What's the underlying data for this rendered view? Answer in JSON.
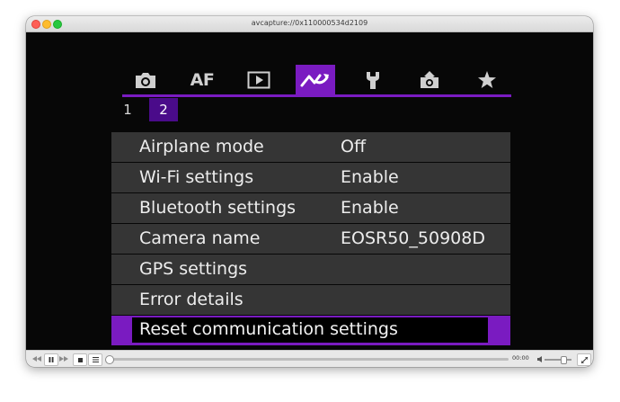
{
  "window": {
    "title": "avcapture://0x110000534d2109"
  },
  "camera_menu": {
    "tabs": [
      {
        "name": "camera-shooting",
        "icon": "camera-icon"
      },
      {
        "name": "af",
        "label": "AF",
        "icon": "af-text"
      },
      {
        "name": "playback",
        "icon": "playback-icon"
      },
      {
        "name": "wireless",
        "icon": "wireless-communication-icon",
        "active": true
      },
      {
        "name": "setup",
        "icon": "wrench-icon"
      },
      {
        "name": "custom-functions",
        "icon": "custom-camera-icon"
      },
      {
        "name": "my-menu",
        "icon": "star-icon"
      }
    ],
    "subtabs": [
      {
        "label": "1",
        "active": false
      },
      {
        "label": "2",
        "active": true
      }
    ],
    "items": [
      {
        "label": "Airplane mode",
        "value": "Off"
      },
      {
        "label": "Wi-Fi settings",
        "value": "Enable"
      },
      {
        "label": "Bluetooth settings",
        "value": "Enable"
      },
      {
        "label": "Camera name",
        "value": "EOSR50_50908D"
      },
      {
        "label": "GPS settings",
        "value": ""
      },
      {
        "label": "Error details",
        "value": ""
      },
      {
        "label": "Reset communication settings",
        "value": "",
        "selected": true
      }
    ],
    "colors": {
      "accent": "#7a1bc1",
      "subtab_active": "#4a0b8a",
      "row_bg": "#353535",
      "background": "#070707"
    }
  },
  "player_controls": {
    "time": "00:00",
    "progress": 0,
    "volume": 0.6,
    "buttons": [
      "skip-back-icon",
      "pause-icon",
      "skip-forward-icon",
      "stop-icon",
      "playlist-icon",
      "volume-icon",
      "fullscreen-icon"
    ]
  }
}
